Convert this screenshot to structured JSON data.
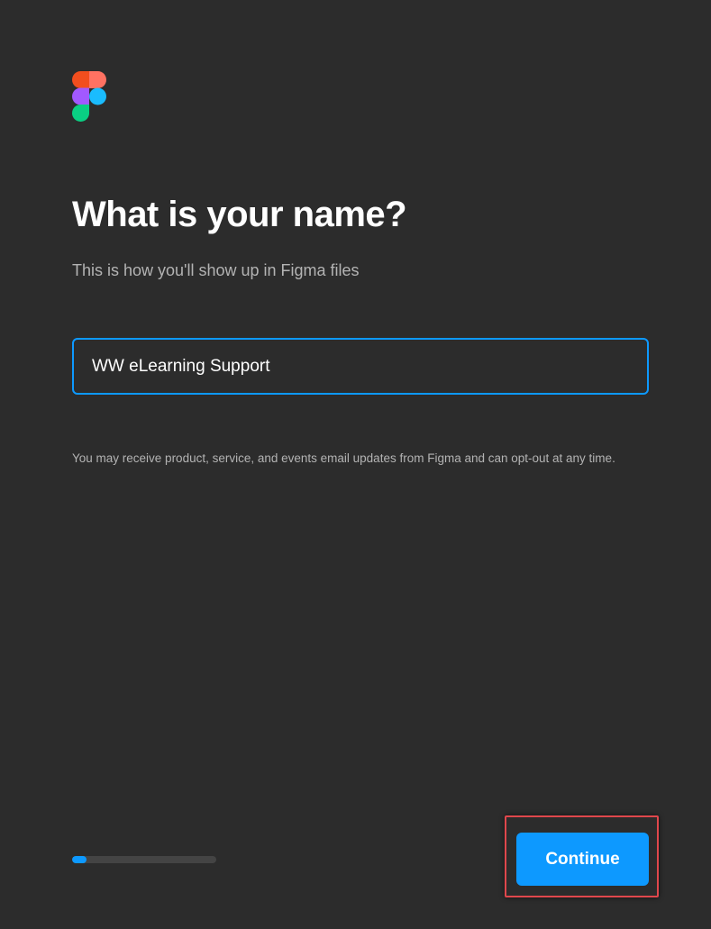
{
  "logo": {
    "name": "figma-logo-icon",
    "colors": [
      "#f24e1e",
      "#ff7262",
      "#a259ff",
      "#1abcfe",
      "#0acf83"
    ]
  },
  "page": {
    "title": "What is your name?",
    "subtitle": "This is how you'll show up in Figma files"
  },
  "name_field": {
    "value": "WW eLearning Support"
  },
  "disclaimer": "You may receive product, service, and events email updates from Figma and can opt-out at any time.",
  "progress": {
    "fraction": 0.1
  },
  "actions": {
    "continue_label": "Continue"
  },
  "colors": {
    "background": "#2c2c2c",
    "accent": "#0d99ff",
    "highlight": "#e0474c"
  }
}
